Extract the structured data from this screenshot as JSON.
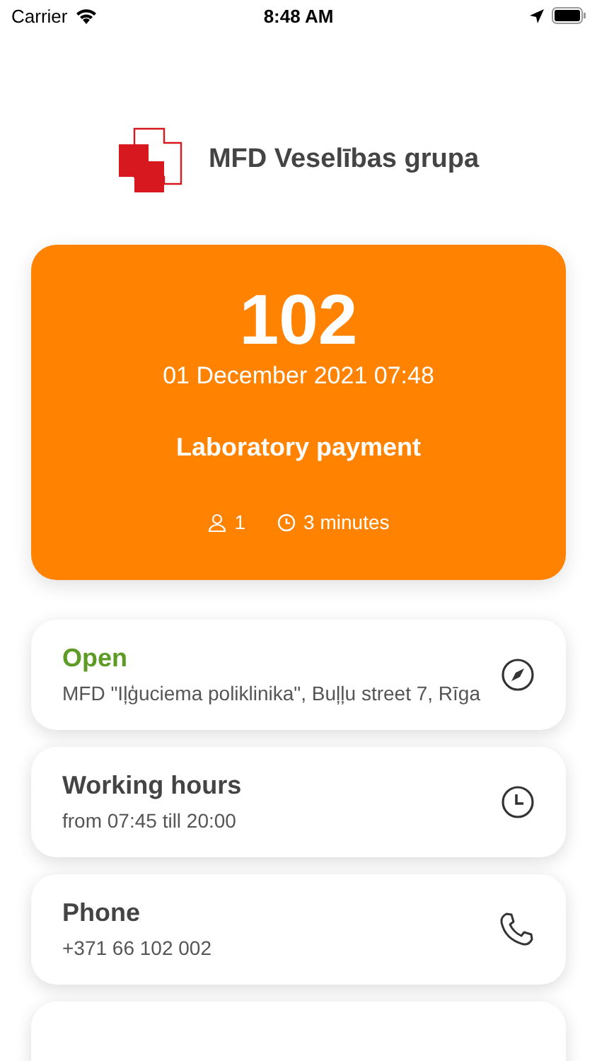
{
  "status_bar": {
    "carrier": "Carrier",
    "time": "8:48 AM"
  },
  "header": {
    "title": "MFD Veselības grupa"
  },
  "ticket": {
    "number": "102",
    "datetime": "01 December 2021 07:48",
    "service": "Laboratory payment",
    "people": "1",
    "wait": "3 minutes"
  },
  "cards": [
    {
      "kind": "location",
      "highlighted": true,
      "title": "Open",
      "text": "MFD \"Iļģuciema poliklinika\", Buļļu street 7, Rīga"
    },
    {
      "kind": "hours",
      "highlighted": false,
      "title": "Working hours",
      "text": "from 07:45 till 20:00"
    },
    {
      "kind": "phone",
      "highlighted": false,
      "title": "Phone",
      "text": "+371 66 102 002"
    }
  ]
}
